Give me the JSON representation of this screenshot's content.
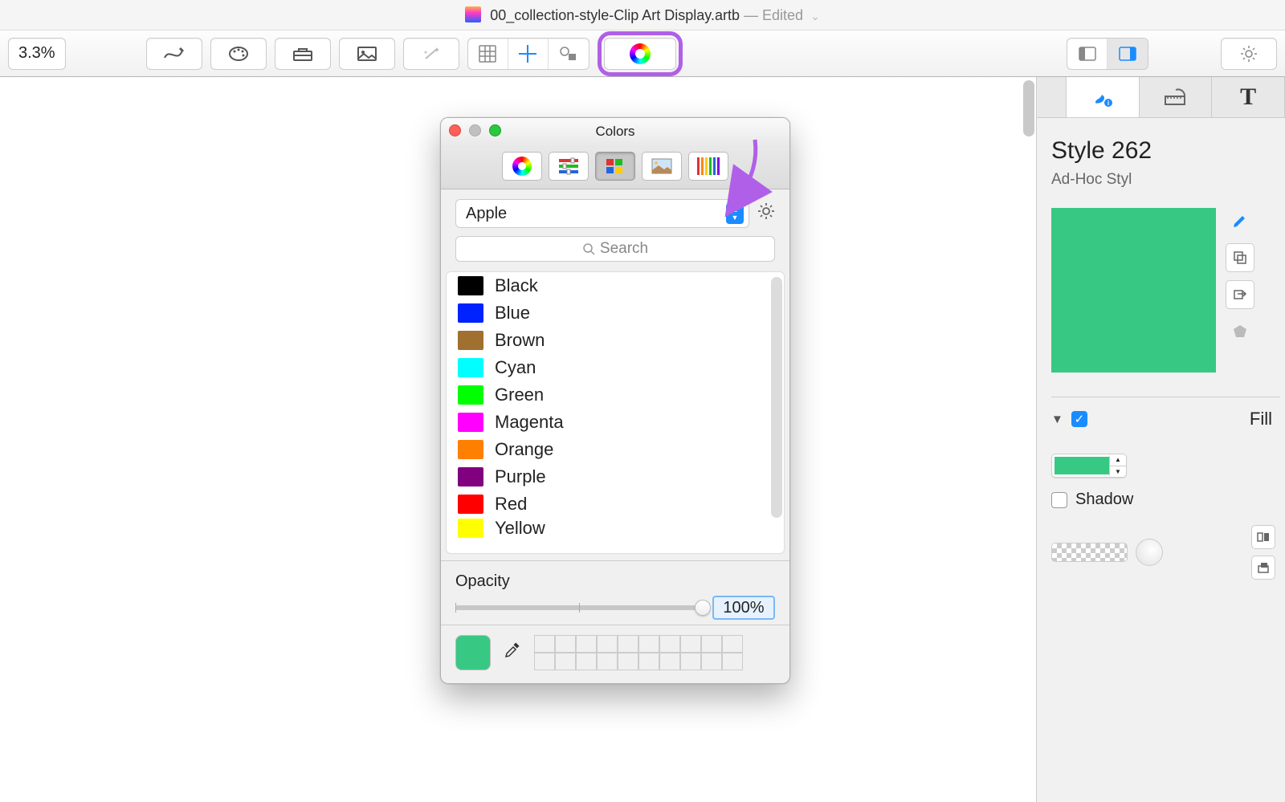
{
  "title": {
    "filename": "00_collection-style-Clip Art Display.artb",
    "edited_label": "— Edited"
  },
  "toolbar": {
    "zoom_value": "3.3%",
    "color_btn_highlighted": true
  },
  "inspector": {
    "style_title": "Style 262",
    "style_subtitle": "Ad-Hoc Styl",
    "preview_color": "#37c983",
    "fill": {
      "disclosed": true,
      "checked": true,
      "label": "Fill"
    },
    "shadow": {
      "checked": false,
      "label": "Shadow"
    }
  },
  "color_window": {
    "title": "Colors",
    "palette_selected": "Apple",
    "search_placeholder": "Search",
    "opacity_label": "Opacity",
    "opacity_value": "100%",
    "current_color": "#37c983",
    "tabs": [
      "wheel",
      "sliders",
      "palettes",
      "image",
      "pencils"
    ],
    "selected_tab_index": 2,
    "items": [
      {
        "name": "Black",
        "color": "#000000"
      },
      {
        "name": "Blue",
        "color": "#0022ff"
      },
      {
        "name": "Brown",
        "color": "#a07030"
      },
      {
        "name": "Cyan",
        "color": "#00ffff"
      },
      {
        "name": "Green",
        "color": "#00ff00"
      },
      {
        "name": "Magenta",
        "color": "#ff00ff"
      },
      {
        "name": "Orange",
        "color": "#ff8000"
      },
      {
        "name": "Purple",
        "color": "#800080"
      },
      {
        "name": "Red",
        "color": "#ff0000"
      },
      {
        "name": "Yellow",
        "color": "#ffff00"
      }
    ]
  }
}
